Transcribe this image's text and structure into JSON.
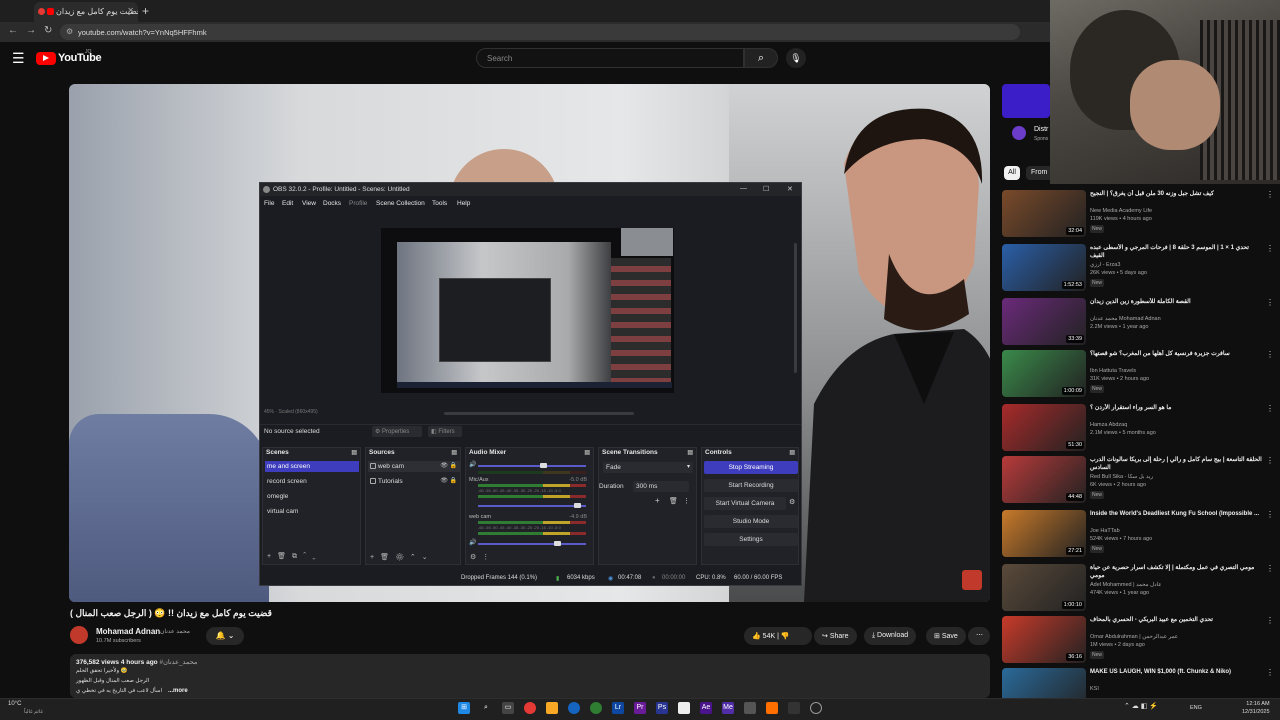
{
  "browser": {
    "tab_title": "قضيت يوم كامل مع زيدان !!",
    "url": "youtube.com/watch?v=YnNq5HFFhmk"
  },
  "youtube": {
    "logo_text": "YouTube",
    "logo_sup": "JO",
    "search_placeholder": "Search"
  },
  "obs": {
    "title": "OBS 32.0.2 - Profile: Untitled - Scenes: Untitled",
    "menu": [
      "File",
      "Edit",
      "View",
      "Docks",
      "Profile",
      "Scene Collection",
      "Tools",
      "Help"
    ],
    "scaled": "45%  ·  Scaled (860x495)",
    "no_source": "No source selected",
    "properties": "Properties",
    "filters": "Filters",
    "docks": {
      "scenes": "Scenes",
      "sources": "Sources",
      "mixer": "Audio Mixer",
      "transitions": "Scene Transitions",
      "controls": "Controls"
    },
    "scenes": [
      "me and screen",
      "record screen",
      "omegle",
      "virtual cam"
    ],
    "sources": [
      "web cam",
      "Tutorials"
    ],
    "mixer": {
      "channels": [
        {
          "name": "Mic/Aux",
          "db": "-5.0 dB",
          "level": 0.62
        },
        {
          "name": "web cam",
          "db": "-4.9 dB",
          "level": 0.64
        }
      ],
      "ticks": "-60 -55 -50 -45 -40 -35 -30 -25 -20 -15 -10 -5 0"
    },
    "transition": "Fade",
    "duration_label": "Duration",
    "duration_value": "300 ms",
    "controls": [
      "Stop Streaming",
      "Start Recording",
      "Start Virtual Camera",
      "Studio Mode",
      "Settings"
    ],
    "status": {
      "dropped": "Dropped Frames 144 (0.1%)",
      "kbps": "6034 kbps",
      "stream_time": "00:47:08",
      "rec_time": "00:00:00",
      "cpu": "CPU: 0.8%",
      "fps": "60.00 / 60.00 FPS"
    }
  },
  "ad": {
    "title": "Distr",
    "sponsored": "Spons"
  },
  "chips": {
    "all": "All",
    "from": "From"
  },
  "recommendations": [
    {
      "title": "كيف تشل جبل وزنه 30 ملن قبل أن يغرق؟ | النجيح",
      "channel": "New Media Academy Life",
      "meta": "119K views • 4 hours ago",
      "new": "New",
      "duration": "32:04",
      "color": "#7a4a2a"
    },
    {
      "title": "تحدي 1 × 1 | الموسم 3 حلقة 8 | فرحات المرجي و الأسطى عبده القيف",
      "channel": "ارزي - Erza3",
      "meta": "26K views • 5 days ago",
      "new": "New",
      "duration": "1:52:53",
      "color": "#2a5fa8"
    },
    {
      "title": "القصة الكاملة للأسطورة زين الدين زيدان",
      "channel": "محمد عدنان Mohamad Adnan",
      "meta": "2.2M views • 1 year ago",
      "new": "",
      "duration": "33:39",
      "color": "#6a2a7a"
    },
    {
      "title": "سافرت جزيرة فرنسية كل أهلها من المغرب؟ شو قصتها؟",
      "channel": "Ibn Hattuta Travels",
      "meta": "31K views • 2 hours ago",
      "new": "New",
      "duration": "1:00:09",
      "color": "#3a8a4a"
    },
    {
      "title": "ما هو السر وراء استقرار الأردن ؟",
      "channel": "Hamza Abdzaq",
      "meta": "2.1M views • 5 months ago",
      "new": "",
      "duration": "51:30",
      "color": "#a82a2a"
    },
    {
      "title": "الحلقة التاسعة | بيج سام كامل و رالي | رحلة إلى بريكا سالونات الدرب السادس",
      "channel": "Red Bull Sika - ريد بل سكا",
      "meta": "6K views • 2 hours ago",
      "new": "New",
      "duration": "44:48",
      "color": "#b83a3a"
    },
    {
      "title": "Inside the World's Deadliest Kung Fu School (Impossible ...",
      "channel": "Joe HaTTab",
      "meta": "524K views • 7 hours ago",
      "new": "New",
      "duration": "27:21",
      "color": "#c87a2a"
    },
    {
      "title": "مومي التصري في عمل ومكتملة | إلا تكشف اسرار حصرية عن حياة مومي",
      "channel": "Adel Mohammed | عادل محمد",
      "meta": "474K views • 1 year ago",
      "new": "",
      "duration": "1:00:10",
      "color": "#5a4a3a"
    },
    {
      "title": "تحدي التخمين مع عبيد البريكي - الحسري بالمحاف",
      "channel": "Omar Abdulrahman | عمر عبدالرحمن",
      "meta": "1M views • 2 days ago",
      "new": "New",
      "duration": "36:16",
      "color": "#c83a2a"
    },
    {
      "title": "MAKE US LAUGH, WIN $1,000 (ft. Chunkz & Niko)",
      "channel": "KSI",
      "meta": "",
      "new": "",
      "duration": "",
      "color": "#2a6a9a"
    }
  ],
  "video": {
    "title": "قضيت يوم كامل مع زيدان !! 😳 ( الرجل صعب المنال )",
    "channel": "Mohamad Adnan",
    "channel_ar": "محمد عدنان",
    "subs": "10.7M subscribers",
    "likes": "54K",
    "share": "Share",
    "download": "Download",
    "save": "Save",
    "views": "376,582 views  4 hours ago",
    "views_ar": "#محمد_عدنان",
    "desc_lines": [
      "ولأخيرا تحقق الحلم 🥹",
      "الرجل صعب المنال وقبل الظهور",
      "اسأل لاعب في التاريخ يه في تخطي ي"
    ],
    "more": "...more"
  },
  "taskbar": {
    "temp": "10°C",
    "weather": "غائم غالباً",
    "lang": "ENG",
    "time": "12:16 AM",
    "date": "12/31/2025"
  }
}
